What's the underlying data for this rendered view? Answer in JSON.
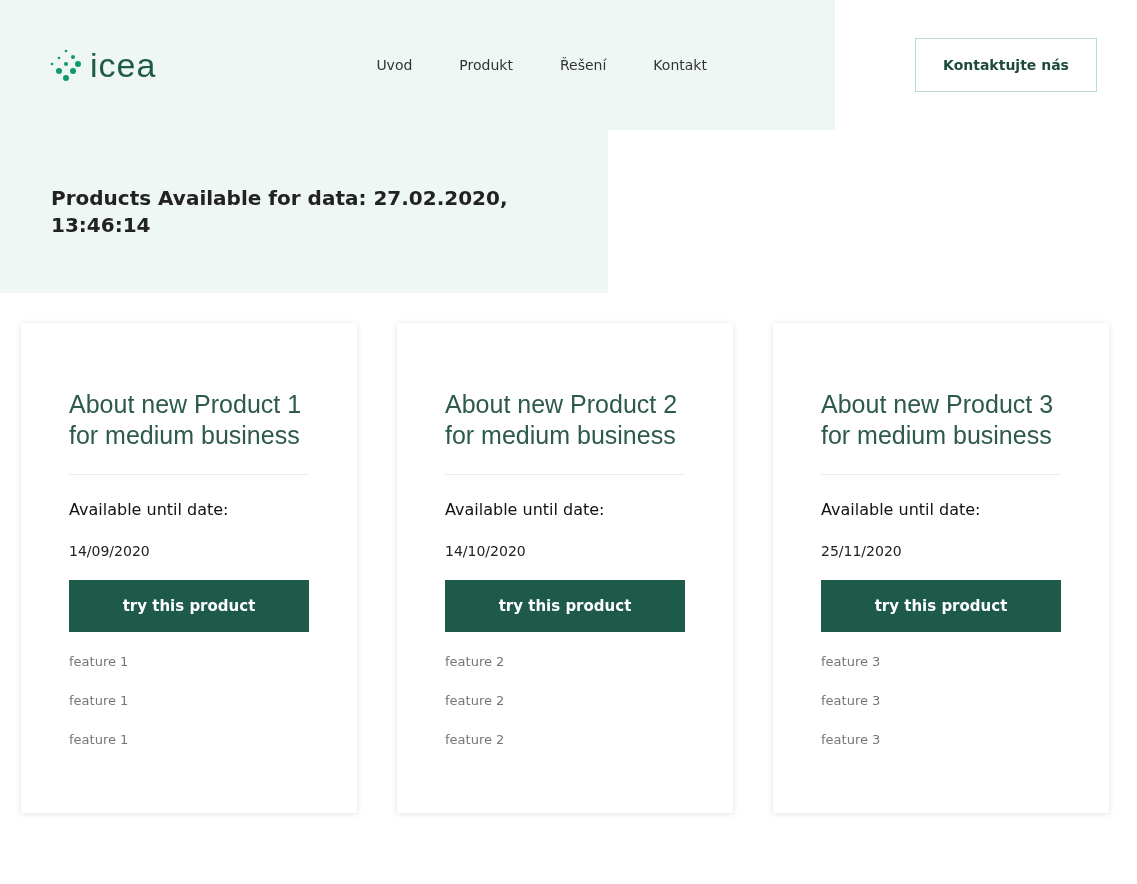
{
  "logo": {
    "text": "icea"
  },
  "nav": [
    {
      "label": "Uvod"
    },
    {
      "label": "Produkt"
    },
    {
      "label": "Řešení"
    },
    {
      "label": "Kontakt"
    }
  ],
  "contact_button": "Kontaktujte nás",
  "hero_title": "Products Available for data: 27.02.2020, 13:46:14",
  "products": [
    {
      "title": "About new Product 1 for medium business",
      "date_label": "Available until date:",
      "date": "14/09/2020",
      "button": "try this product",
      "features": [
        "feature 1",
        "feature 1",
        "feature 1"
      ]
    },
    {
      "title": "About new Product 2 for medium business",
      "date_label": "Available until date:",
      "date": "14/10/2020",
      "button": "try this product",
      "features": [
        "feature 2",
        "feature 2",
        "feature 2"
      ]
    },
    {
      "title": "About new Product 3 for medium business",
      "date_label": "Available until date:",
      "date": "25/11/2020",
      "button": "try this product",
      "features": [
        "feature 3",
        "feature 3",
        "feature 3"
      ]
    }
  ]
}
